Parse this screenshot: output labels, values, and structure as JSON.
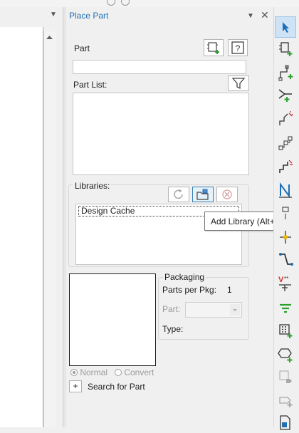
{
  "panel": {
    "title": "Place Part",
    "part_label": "Part",
    "part_value": "",
    "part_list_label": "Part List:",
    "libraries_label": "Libraries:",
    "library_items": [
      "Design Cache"
    ],
    "tooltip": "Add Library (Alt+A)"
  },
  "packaging": {
    "title": "Packaging",
    "parts_per_pkg_label": "Parts per Pkg:",
    "parts_per_pkg_value": "1",
    "part_label": "Part:",
    "type_label": "Type:"
  },
  "view_options": {
    "normal_label": "Normal",
    "convert_label": "Convert",
    "selected": "Normal"
  },
  "search": {
    "expand_symbol": "+",
    "label": "Search for Part"
  },
  "colors": {
    "accent": "#1f6fb5",
    "green": "#2e9e2e",
    "red": "#d32f2f",
    "selected_bg": "#cfe3f7"
  },
  "toolbar": {
    "tools": [
      "select-tool-icon",
      "place-part-icon",
      "place-wire-icon",
      "place-bus-icon",
      "bus-entry-icon",
      "net-alias-icon",
      "net-group-icon",
      "place-net-icon",
      "junction-icon",
      "no-connect-icon",
      "power-icon",
      "ground-icon",
      "off-page-connector-icon",
      "hierarchical-port-icon",
      "hierarchical-block-icon",
      "hierarchical-pin-icon",
      "place-text-icon"
    ]
  }
}
